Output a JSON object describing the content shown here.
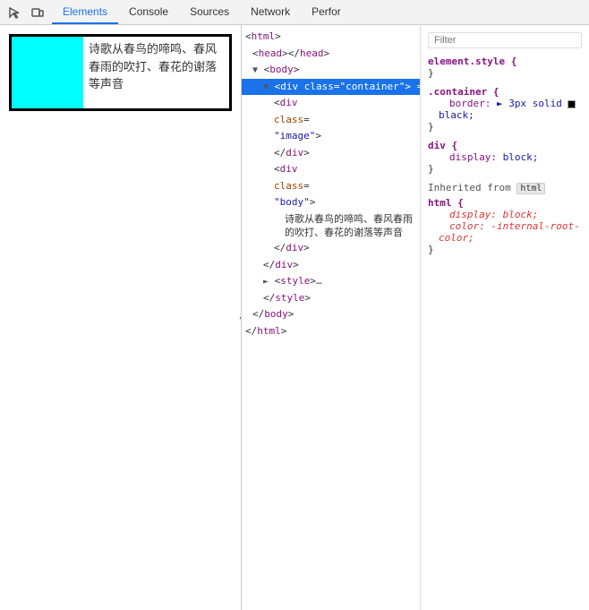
{
  "toolbar": {
    "tabs": [
      {
        "label": "Elements",
        "active": true
      },
      {
        "label": "Console",
        "active": false
      },
      {
        "label": "Sources",
        "active": false
      },
      {
        "label": "Network",
        "active": false
      },
      {
        "label": "Perfor",
        "active": false
      }
    ]
  },
  "preview": {
    "text": "诗歌从春鸟的啼鸣、春风春雨的吹打、春花的谢落等声音"
  },
  "elements_tree": [
    {
      "indent": 0,
      "content": "<html>",
      "type": "open-tag"
    },
    {
      "indent": 1,
      "content": "<head></head>",
      "type": "self"
    },
    {
      "indent": 1,
      "content": "▼ <body>",
      "type": "open-tag"
    },
    {
      "indent": 2,
      "content": "▼ <div class=\"container\"> =",
      "type": "selected"
    },
    {
      "indent": 3,
      "content": "<div",
      "type": "open-tag"
    },
    {
      "indent": 3,
      "content": "class=",
      "type": "attr"
    },
    {
      "indent": 3,
      "content": "\"image\">",
      "type": "attr-val"
    },
    {
      "indent": 3,
      "content": "</div>",
      "type": "close-tag"
    },
    {
      "indent": 3,
      "content": "<div",
      "type": "open-tag"
    },
    {
      "indent": 3,
      "content": "class=",
      "type": "attr"
    },
    {
      "indent": 3,
      "content": "\"body\">",
      "type": "attr-val"
    },
    {
      "indent": 4,
      "content": "诗歌从春鸟的啼鸣、春风春雨的吹打、春花的谢落等声音",
      "type": "text"
    },
    {
      "indent": 3,
      "content": "</div>",
      "type": "close-tag"
    },
    {
      "indent": 2,
      "content": "</div>",
      "type": "close-tag"
    },
    {
      "indent": 2,
      "content": "► <style>…",
      "type": "collapsed"
    },
    {
      "indent": 2,
      "content": "</style>",
      "type": "close-tag"
    },
    {
      "indent": 1,
      "content": "</body>",
      "type": "close-tag"
    },
    {
      "indent": 0,
      "content": "</html>",
      "type": "close-tag"
    }
  ],
  "styles": {
    "filter_placeholder": "Filter",
    "blocks": [
      {
        "selector": "element.style {",
        "rules": [],
        "close": "}"
      },
      {
        "selector": ".container {",
        "rules": [
          {
            "prop": "border:",
            "value": "► 3px solid",
            "swatch": true,
            "swatch_color": "#000",
            "extra": "black;"
          }
        ],
        "close": "}"
      },
      {
        "selector": "div {",
        "rules": [
          {
            "prop": "display:",
            "value": "block;"
          }
        ],
        "close": "}"
      }
    ],
    "inherited_from": "html",
    "inherited_blocks": [
      {
        "selector": "html {",
        "rules": [
          {
            "prop": "display:",
            "value": "block;",
            "italic": true
          },
          {
            "prop": "color:",
            "value": "-internal-root-color;",
            "italic": true
          }
        ],
        "close": "}"
      }
    ]
  }
}
